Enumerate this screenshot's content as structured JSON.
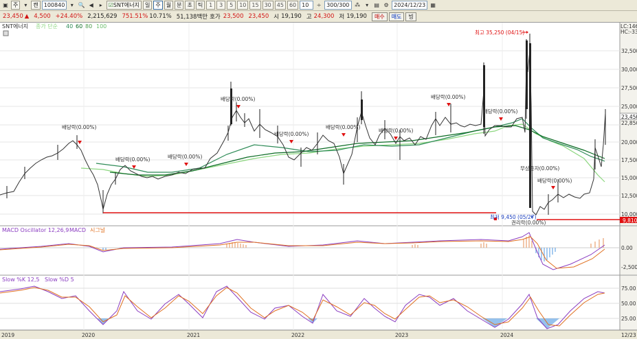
{
  "toolbar": {
    "view_mode": "주",
    "chart_type": "캔",
    "code": "100840",
    "stock_name": "SNT에너지",
    "periods": [
      "일",
      "주",
      "월",
      "분",
      "초",
      "틱"
    ],
    "minutes": [
      "1",
      "3",
      "5",
      "10",
      "15",
      "30",
      "45",
      "60"
    ],
    "custom_minute": "10",
    "count": "300/300",
    "date": "2024/12/23"
  },
  "quote": {
    "price": "23,450",
    "change_symbol": "▲",
    "change": "4,500",
    "change_pct": "+24.40%",
    "volume": "2,215,629",
    "volume_ratio": "751.51%",
    "turnover": "10.71%",
    "amount": "51,138백만",
    "ask_label": "호가",
    "ask": "23,500",
    "bid": "23,450",
    "open_label": "시",
    "open": "19,190",
    "high_label": "고",
    "high": "24,300",
    "low_label": "저",
    "low": "19,190",
    "buy_button": "매수",
    "sell_button": "매도",
    "extra_button": "빙"
  },
  "colors": {
    "up": "#d21414",
    "down": "#1a3fbf",
    "ma5": "#2e8b57",
    "ma20": "#0b6b24",
    "ma60": "#8bd67e",
    "support": "#e01010"
  },
  "price_panel": {
    "legend_name": "SNT에너지",
    "legend_ma": "종가 단순",
    "legend_periods": [
      "40",
      "60",
      "80",
      "100"
    ],
    "top_right_labels": [
      "LC:146",
      "HC:-33"
    ],
    "y_ticks": [
      "32,500",
      "30,000",
      "27,500",
      "25,000",
      "22,500",
      "20,000",
      "17,500",
      "15,000",
      "12,500",
      "10,000"
    ],
    "current_price_tags": [
      "23,450",
      "22,850"
    ],
    "support_tag": "9,810",
    "high_annotation": "최고 35,250 (04/15)",
    "low_annotation": "최저 9,450 (05/27)",
    "annotations": [
      "배당락(0.00%)",
      "배당락(0.00%)",
      "배당락(0.00%)",
      "배당락(0.00%)",
      "배당락(0.00%)",
      "배당락(0.00%)",
      "배당락(0.00%)",
      "배당락(0.00%)",
      "배당락(0.00%)",
      "배당락(0.00%)",
      "무상증자(0.00%)",
      "권리락(0.00%)"
    ]
  },
  "macd_panel": {
    "legend": "MACD Oscillator 12,26,9",
    "legend_macd": "MACD",
    "legend_signal": "시그널",
    "y_ticks": [
      "0.00",
      "-2,500"
    ]
  },
  "slow_panel": {
    "legend_k": "Slow %K 12,5",
    "legend_d": "Slow %D 5",
    "y_ticks": [
      "75.00",
      "50.00",
      "25.00"
    ]
  },
  "x_axis": {
    "labels": [
      "2019",
      "2020",
      "2021",
      "2022",
      "2023",
      "2024"
    ],
    "end_label": "12/23"
  }
}
